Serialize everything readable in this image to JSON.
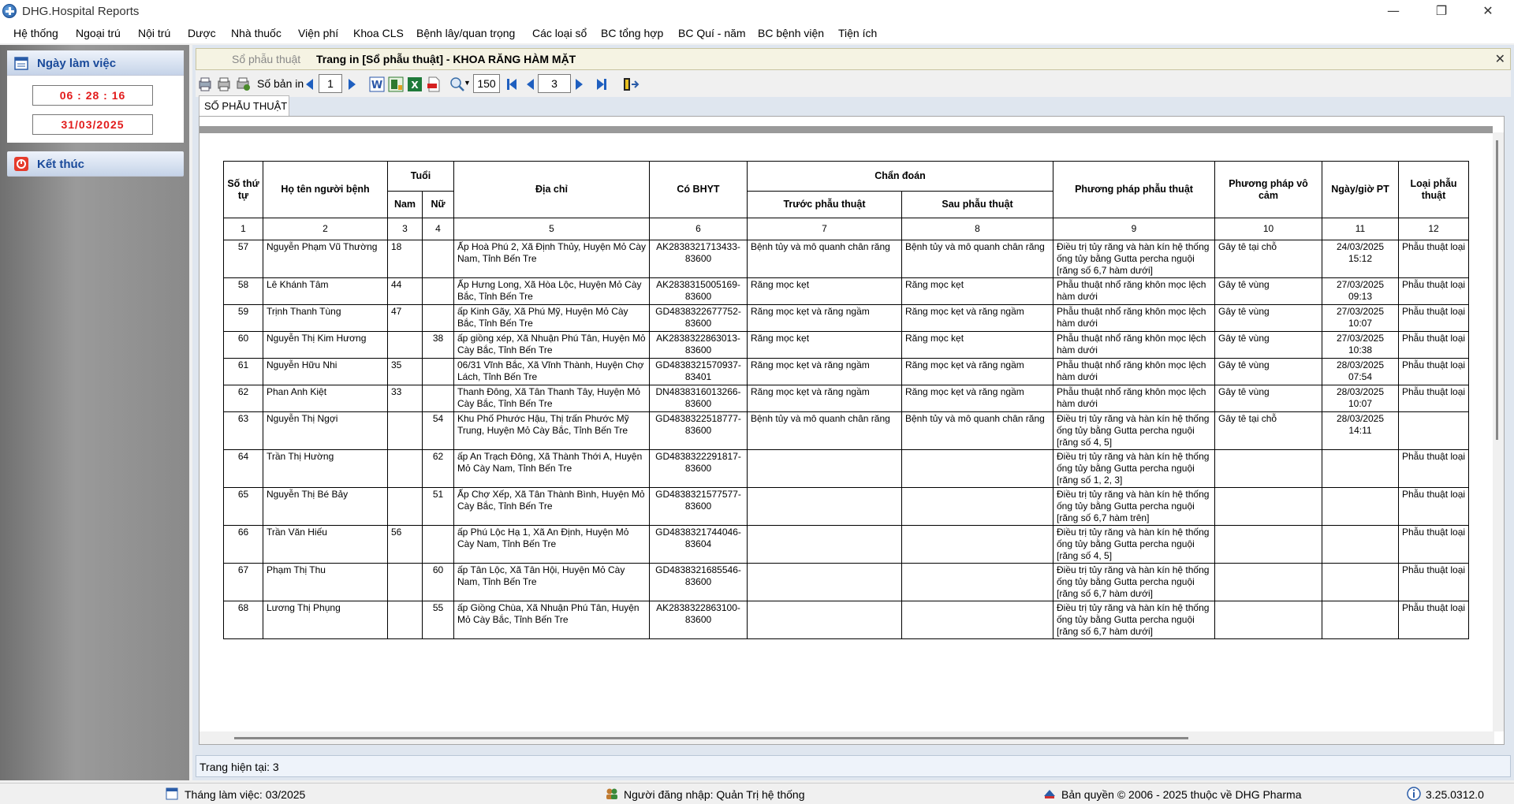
{
  "window": {
    "title": "DHG.Hospital Reports",
    "min": "—",
    "max": "❐",
    "close": "✕"
  },
  "menu": [
    "Hệ thống",
    "Ngoại trú",
    "Nội trú",
    "Dược",
    "Nhà thuốc",
    "Viện phí",
    "Khoa CLS",
    "Bệnh lây/quan trọng",
    "Các loại sổ",
    "BC tổng hợp",
    "BC Quí - năm",
    "BC bệnh viện",
    "Tiện ích"
  ],
  "sidebar": {
    "workday_label": "Ngày làm việc",
    "time": "06 : 28 : 16",
    "date": "31/03/2025",
    "exit_label": "Kết thúc"
  },
  "tabs": {
    "inactive": "Sổ phẫu thuật",
    "active": "Trang in [Sổ phẫu thuật] - KHOA RĂNG HÀM MẶT",
    "close": "✕"
  },
  "toolbar": {
    "copies_label": "Số bản in",
    "copies_value": "1",
    "zoom_value": "150",
    "page_value": "3"
  },
  "subtab": "SỐ PHẪU THUẬT",
  "report": {
    "headers": {
      "stt": "Số thứ tự",
      "name": "Họ tên người bệnh",
      "age": "Tuổi",
      "male": "Nam",
      "female": "Nữ",
      "address": "Địa chỉ",
      "bhyt": "Có BHYT",
      "diagnosis": "Chẩn đoán",
      "before": "Trước phẫu thuật",
      "after": "Sau phẫu thuật",
      "method": "Phương pháp phẫu thuật",
      "anesthesia": "Phương pháp vô cảm",
      "datetime": "Ngày/giờ PT",
      "type": "Loại phẫu thuật"
    },
    "col_numbers": [
      "1",
      "2",
      "3",
      "4",
      "5",
      "6",
      "7",
      "8",
      "9",
      "10",
      "11",
      "12"
    ],
    "rows": [
      {
        "stt": "57",
        "name": "Nguyễn Phạm Vũ Thường",
        "male": "18",
        "female": "",
        "address": "Ấp Hoà Phú 2, Xã Định Thủy, Huyện Mỏ Cày Nam, Tỉnh Bến Tre",
        "bhyt": "AK2838321713433-83600",
        "before": "Bệnh tủy và mô quanh chân răng",
        "after": "Bệnh tủy và mô quanh chân răng",
        "method": "Điều trị tủy răng và hàn kín hệ thống ống tủy bằng Gutta percha nguội [răng số 6,7 hàm dưới]",
        "anesthesia": "Gây tê tại chỗ",
        "datetime": "24/03/2025 15:12",
        "type": "Phẫu thuật loại"
      },
      {
        "stt": "58",
        "name": "Lê Khánh Tâm",
        "male": "44",
        "female": "",
        "address": "Ấp Hưng Long, Xã Hòa Lộc, Huyện Mỏ Cày Bắc, Tỉnh Bến Tre",
        "bhyt": "AK2838315005169-83600",
        "before": "Răng mọc kẹt",
        "after": "Răng mọc kẹt",
        "method": "Phẫu thuật nhổ răng khôn mọc lệch hàm dưới",
        "anesthesia": "Gây tê vùng",
        "datetime": "27/03/2025 09:13",
        "type": "Phẫu thuật loại"
      },
      {
        "stt": "59",
        "name": "Trịnh Thanh Tùng",
        "male": "47",
        "female": "",
        "address": "ấp Kinh Gãy, Xã Phú Mỹ, Huyện Mỏ Cày Bắc, Tỉnh Bến Tre",
        "bhyt": "GD4838322677752-83600",
        "before": "Răng mọc kẹt và răng ngầm",
        "after": "Răng mọc kẹt và răng ngầm",
        "method": "Phẫu thuật nhổ răng khôn mọc lệch hàm dưới",
        "anesthesia": "Gây tê vùng",
        "datetime": "27/03/2025 10:07",
        "type": "Phẫu thuật loại"
      },
      {
        "stt": "60",
        "name": "Nguyễn Thị Kim Hương",
        "male": "",
        "female": "38",
        "address": "ấp giồng xép, Xã Nhuận Phú Tân, Huyện Mỏ Cày Bắc, Tỉnh Bến Tre",
        "bhyt": "AK2838322863013-83600",
        "before": "Răng mọc kẹt",
        "after": "Răng mọc kẹt",
        "method": "Phẫu thuật nhổ răng khôn mọc lệch hàm dưới",
        "anesthesia": "Gây tê vùng",
        "datetime": "27/03/2025 10:38",
        "type": "Phẫu thuật loại"
      },
      {
        "stt": "61",
        "name": "Nguyễn Hữu Nhi",
        "male": "35",
        "female": "",
        "address": "06/31 Vĩnh Bắc, Xã Vĩnh Thành, Huyện Chợ Lách, Tỉnh Bến Tre",
        "bhyt": "GD4838321570937-83401",
        "before": "Răng mọc kẹt và răng ngầm",
        "after": "Răng mọc kẹt và răng ngầm",
        "method": "Phẫu thuật nhổ răng khôn mọc lệch hàm dưới",
        "anesthesia": "Gây tê vùng",
        "datetime": "28/03/2025 07:54",
        "type": "Phẫu thuật loại"
      },
      {
        "stt": "62",
        "name": "Phan Anh Kiệt",
        "male": "33",
        "female": "",
        "address": "Thanh Đông, Xã Tân Thanh Tây, Huyện Mỏ Cày Bắc, Tỉnh Bến Tre",
        "bhyt": "DN4838316013266-83600",
        "before": "Răng mọc kẹt và răng ngầm",
        "after": "Răng mọc kẹt và răng ngầm",
        "method": "Phẫu thuật nhổ răng khôn mọc lệch hàm dưới",
        "anesthesia": "Gây tê vùng",
        "datetime": "28/03/2025 10:07",
        "type": "Phẫu thuật loại"
      },
      {
        "stt": "63",
        "name": "Nguyễn Thị Ngợi",
        "male": "",
        "female": "54",
        "address": "Khu Phố Phước Hậu, Thị trấn Phước Mỹ Trung, Huyện Mỏ Cày Bắc, Tỉnh Bến Tre",
        "bhyt": "GD4838322518777-83600",
        "before": "Bệnh tủy và mô quanh chân răng",
        "after": "Bệnh tủy và mô quanh chân răng",
        "method": "Điều trị tủy răng và hàn kín hệ thống ống tủy bằng Gutta percha nguội [răng số 4, 5]",
        "anesthesia": "Gây tê tại chỗ",
        "datetime": "28/03/2025 14:11",
        "type": ""
      },
      {
        "stt": "64",
        "name": "Trần Thị Hường",
        "male": "",
        "female": "62",
        "address": "ấp An Trạch Đông, Xã Thành Thới A, Huyện Mỏ Cày Nam, Tỉnh Bến Tre",
        "bhyt": "GD4838322291817-83600",
        "before": "",
        "after": "",
        "method": "Điều trị tủy răng và hàn kín hệ thống ống tủy bằng Gutta percha nguội [răng số 1, 2, 3]",
        "anesthesia": "",
        "datetime": "",
        "type": "Phẫu thuật loại"
      },
      {
        "stt": "65",
        "name": "Nguyễn Thị Bé Bảy",
        "male": "",
        "female": "51",
        "address": "Ấp Chợ Xếp, Xã Tân Thành Bình, Huyện Mỏ Cày Bắc, Tỉnh Bến Tre",
        "bhyt": "GD4838321577577-83600",
        "before": "",
        "after": "",
        "method": "Điều trị tủy răng và hàn kín hệ thống ống tủy bằng Gutta percha nguội [răng số 6,7 hàm trên]",
        "anesthesia": "",
        "datetime": "",
        "type": "Phẫu thuật loại"
      },
      {
        "stt": "66",
        "name": "Trần Văn Hiếu",
        "male": "56",
        "female": "",
        "address": "ấp Phú Lộc Hạ 1, Xã An Định, Huyện Mỏ Cày Nam, Tỉnh Bến Tre",
        "bhyt": "GD4838321744046-83604",
        "before": "",
        "after": "",
        "method": "Điều trị tủy răng và hàn kín hệ thống ống tủy bằng Gutta percha nguội [răng số 4, 5]",
        "anesthesia": "",
        "datetime": "",
        "type": "Phẫu thuật loại"
      },
      {
        "stt": "67",
        "name": "Phạm Thị Thu",
        "male": "",
        "female": "60",
        "address": "ấp Tân Lộc, Xã Tân Hội, Huyện Mỏ Cày Nam, Tỉnh Bến Tre",
        "bhyt": "GD4838321685546-83600",
        "before": "",
        "after": "",
        "method": "Điều trị tủy răng và hàn kín hệ thống ống tủy bằng Gutta percha nguội [răng số 6,7 hàm dưới]",
        "anesthesia": "",
        "datetime": "",
        "type": "Phẫu thuật loại"
      },
      {
        "stt": "68",
        "name": "Lương Thị Phụng",
        "male": "",
        "female": "55",
        "address": "ấp Giồng Chùa, Xã Nhuận Phú Tân, Huyện Mỏ Cày Bắc, Tỉnh Bến Tre",
        "bhyt": "AK2838322863100-83600",
        "before": "",
        "after": "",
        "method": "Điều trị tủy răng và hàn kín hệ thống ống tủy bằng Gutta percha nguội [răng số 6,7 hàm dưới]",
        "anesthesia": "",
        "datetime": "",
        "type": "Phẫu thuật loại"
      }
    ]
  },
  "status": {
    "current_page": "Trang hiện tại:  3"
  },
  "footer": {
    "month": "Tháng làm việc: 03/2025",
    "user": "Người đăng nhập: Quản Trị hệ thống",
    "copyright": "Bản quyền © 2006 - 2025 thuộc về DHG Pharma",
    "version": "3.25.0312.0"
  }
}
